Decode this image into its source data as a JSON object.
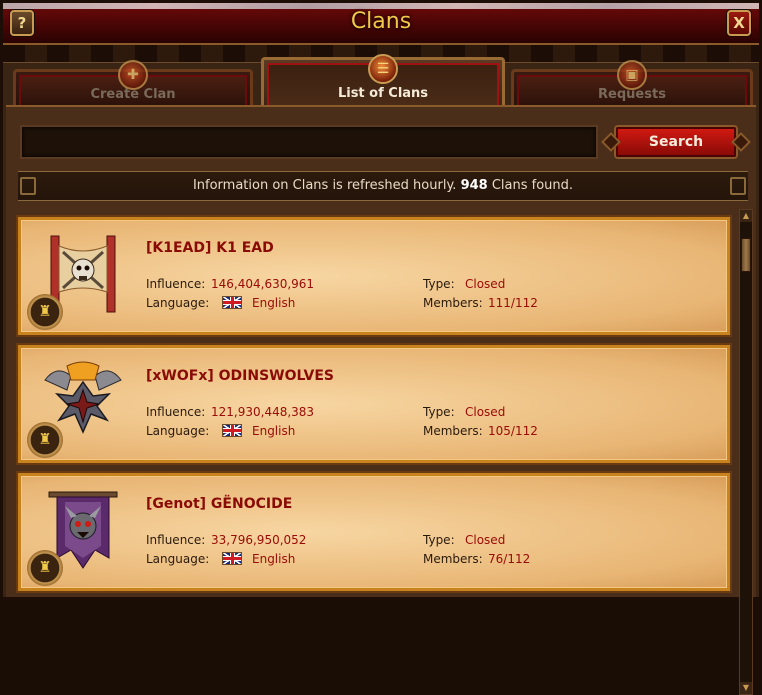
{
  "window": {
    "title": "Clans",
    "help_label": "?",
    "close_label": "X"
  },
  "tabs": [
    {
      "label": "Create Clan",
      "icon": "shield-plus-icon",
      "active": false
    },
    {
      "label": "List of Clans",
      "icon": "clan-list-icon",
      "active": true
    },
    {
      "label": "Requests",
      "icon": "scroll-request-icon",
      "active": false
    }
  ],
  "search": {
    "value": "",
    "placeholder": "",
    "button_label": "Search"
  },
  "info": {
    "prefix": "Information on Clans is refreshed hourly.",
    "count": "948",
    "suffix": "Clans found."
  },
  "labels": {
    "influence": "Influence:",
    "language": "Language:",
    "type": "Type:",
    "members": "Members:"
  },
  "clans": [
    {
      "name": "[K1EAD] K1 EAD",
      "influence": "146,404,630,961",
      "language": "English",
      "type": "Closed",
      "members": "111/112",
      "emblem": "skull-banner-emblem"
    },
    {
      "name": "[xWOFx] ODINSWOLVES",
      "influence": "121,930,448,383",
      "language": "English",
      "type": "Closed",
      "members": "105/112",
      "emblem": "iron-cross-wolves-emblem"
    },
    {
      "name": "[Genot] GËNOCIDE",
      "influence": "33,796,950,052",
      "language": "English",
      "type": "Closed",
      "members": "76/112",
      "emblem": "demon-banner-emblem"
    }
  ],
  "colors": {
    "title": "#f0c84a",
    "accent_red": "#9a0a06",
    "card_border": "#c8821e"
  }
}
